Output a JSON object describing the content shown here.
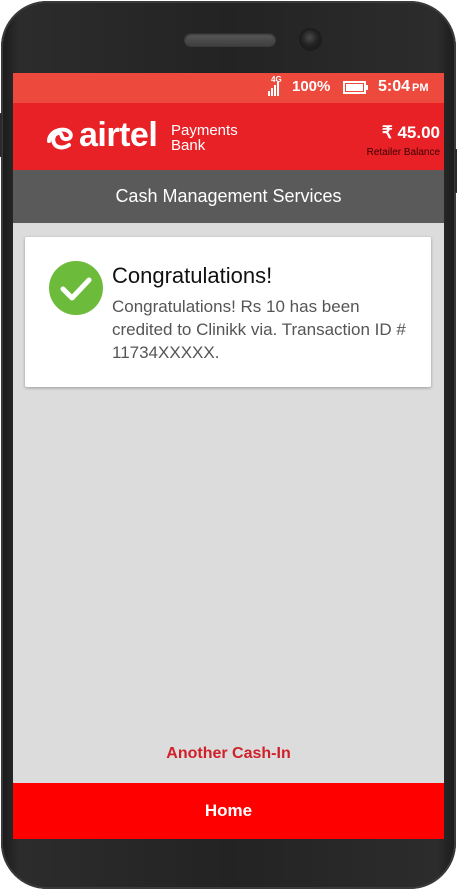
{
  "status_bar": {
    "network": "4G",
    "battery_percent": "100%",
    "time": "5:04",
    "am_pm": "PM"
  },
  "header": {
    "logo_word": "airtel",
    "logo_sub_line1": "Payments",
    "logo_sub_line2": "Bank",
    "balance_amount": "₹ 45.00",
    "balance_caption": "Retailer Balance"
  },
  "page_title": "Cash Management Services",
  "card": {
    "icon": "check-circle-icon",
    "title": "Congratulations!",
    "message": "Congratulations! Rs 10 has been credited to Clinikk via. Transaction ID # 11734XXXXX."
  },
  "actions": {
    "another_cash_in": "Another Cash-In",
    "home": "Home"
  },
  "colors": {
    "status_bar": "#ed4a3d",
    "header": "#e82127",
    "title_bar": "#5a5a5a",
    "success": "#6dbb3a",
    "home_button": "#ff0000",
    "link": "#d0202a",
    "background": "#dcdcdc"
  }
}
